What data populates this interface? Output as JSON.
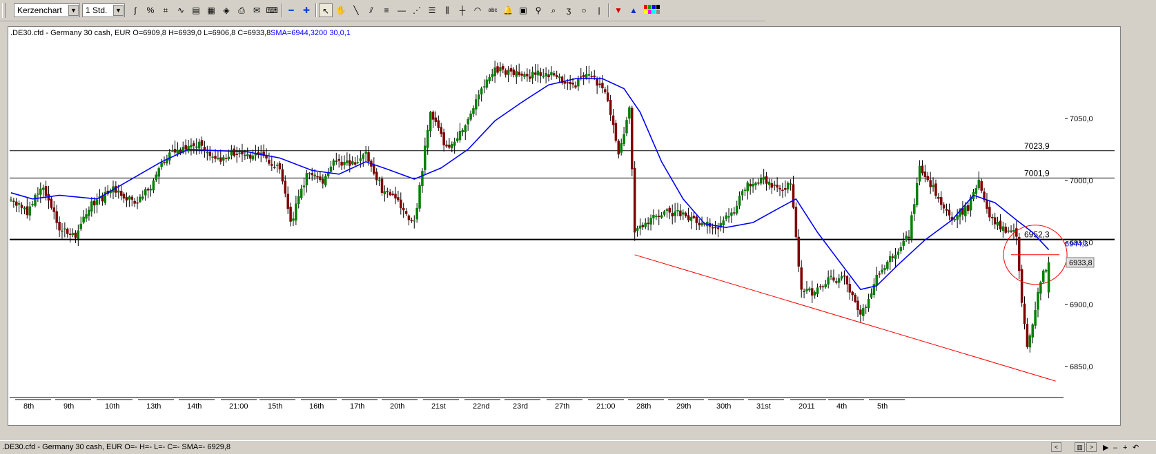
{
  "toolbar": {
    "chart_type": "Kerzenchart",
    "timeframe": "1 Std.",
    "icons": [
      "indicator-icon",
      "percent-icon",
      "crosshair-grid-icon",
      "line-tool-icon",
      "window-icon",
      "chart-window-icon",
      "book-icon",
      "print-icon",
      "mail-icon",
      "keyboard-icon",
      "zoom-out-icon",
      "zoom-in-icon",
      "pointer-icon",
      "hand-icon",
      "line-icon",
      "parallel-lines-icon",
      "channel-icon",
      "horizontal-line-icon",
      "fan-icon",
      "fibonacci-icon",
      "fibonacci-time-icon",
      "cross-icon",
      "arc-icon",
      "text-icon",
      "bell-icon",
      "calculator-icon",
      "search-icon",
      "zoom-area-icon",
      "freehand-icon",
      "circle-icon",
      "vertical-line-icon",
      "sell-arrow-icon",
      "buy-arrow-icon",
      "color-palette-icon"
    ]
  },
  "chart": {
    "header": ".DE30.cfd - Germany 30 cash, EUR O=6909,8 H=6939,0 L=6906,8 C=6933,8",
    "indicator": "SMA=6944,3200  30,0,1",
    "ytick_labels": [
      "7050,0",
      "7000,0",
      "6950,0",
      "6900,0",
      "6850,0"
    ],
    "hline_labels": [
      "7023,9",
      "7001,9",
      "6952,3"
    ],
    "price_tag": "6933,8",
    "sma_tag": "6944,3",
    "date_labels": [
      "8th",
      "9th",
      "10th",
      "13th",
      "14th",
      "21:00",
      "15th",
      "16th",
      "17th",
      "20th",
      "21st",
      "22nd",
      "23rd",
      "27th",
      "21:00",
      "28th",
      "29th",
      "30th",
      "31st",
      "2011",
      "4th",
      "5th"
    ],
    "colors": {
      "up": "#008000",
      "down": "#800000",
      "sma": "#0000ff",
      "trend": "#ff0000",
      "hline": "#000000"
    }
  },
  "chart_data": {
    "type": "candlestick",
    "symbol": ".DE30.cfd - Germany 30 cash",
    "timeframe": "1 Std.",
    "last_bar": {
      "open": 6909.8,
      "high": 6939.0,
      "low": 6906.8,
      "close": 6933.8
    },
    "sma": {
      "value": 6944.32,
      "params": "30,0,1"
    },
    "horizontal_lines": [
      7023.9,
      7001.9,
      6952.3
    ],
    "ylim": [
      6826,
      7116
    ],
    "yticks": [
      7050,
      7000,
      6950,
      6900,
      6850
    ],
    "close_path": [
      {
        "i": 0,
        "c": 6985
      },
      {
        "i": 6,
        "c": 6975
      },
      {
        "i": 12,
        "c": 6996
      },
      {
        "i": 18,
        "c": 6962
      },
      {
        "i": 24,
        "c": 6955
      },
      {
        "i": 30,
        "c": 6980
      },
      {
        "i": 38,
        "c": 6992
      },
      {
        "i": 46,
        "c": 6982
      },
      {
        "i": 52,
        "c": 6996
      },
      {
        "i": 58,
        "c": 7020
      },
      {
        "i": 64,
        "c": 7025
      },
      {
        "i": 70,
        "c": 7030
      },
      {
        "i": 76,
        "c": 7015
      },
      {
        "i": 82,
        "c": 7022
      },
      {
        "i": 88,
        "c": 7018
      },
      {
        "i": 94,
        "c": 7020
      },
      {
        "i": 100,
        "c": 7008
      },
      {
        "i": 104,
        "c": 6965
      },
      {
        "i": 110,
        "c": 7005
      },
      {
        "i": 116,
        "c": 7000
      },
      {
        "i": 120,
        "c": 7018
      },
      {
        "i": 126,
        "c": 7012
      },
      {
        "i": 132,
        "c": 7020
      },
      {
        "i": 138,
        "c": 6993
      },
      {
        "i": 144,
        "c": 6982
      },
      {
        "i": 150,
        "c": 6965
      },
      {
        "i": 156,
        "c": 7055
      },
      {
        "i": 162,
        "c": 7025
      },
      {
        "i": 168,
        "c": 7040
      },
      {
        "i": 174,
        "c": 7068
      },
      {
        "i": 180,
        "c": 7090
      },
      {
        "i": 186,
        "c": 7086
      },
      {
        "i": 192,
        "c": 7084
      },
      {
        "i": 198,
        "c": 7087
      },
      {
        "i": 204,
        "c": 7082
      },
      {
        "i": 210,
        "c": 7078
      },
      {
        "i": 216,
        "c": 7086
      },
      {
        "i": 222,
        "c": 7065
      },
      {
        "i": 226,
        "c": 7020
      },
      {
        "i": 230,
        "c": 7058
      },
      {
        "i": 232,
        "c": 6958
      },
      {
        "i": 238,
        "c": 6968
      },
      {
        "i": 244,
        "c": 6975
      },
      {
        "i": 250,
        "c": 6972
      },
      {
        "i": 256,
        "c": 6965
      },
      {
        "i": 262,
        "c": 6962
      },
      {
        "i": 268,
        "c": 6972
      },
      {
        "i": 274,
        "c": 6998
      },
      {
        "i": 280,
        "c": 7000
      },
      {
        "i": 286,
        "c": 6993
      },
      {
        "i": 290,
        "c": 6998
      },
      {
        "i": 294,
        "c": 6912
      },
      {
        "i": 298,
        "c": 6910
      },
      {
        "i": 304,
        "c": 6920
      },
      {
        "i": 310,
        "c": 6920
      },
      {
        "i": 316,
        "c": 6890
      },
      {
        "i": 322,
        "c": 6922
      },
      {
        "i": 328,
        "c": 6940
      },
      {
        "i": 334,
        "c": 6955
      },
      {
        "i": 338,
        "c": 7010
      },
      {
        "i": 344,
        "c": 6990
      },
      {
        "i": 350,
        "c": 6970
      },
      {
        "i": 356,
        "c": 6978
      },
      {
        "i": 360,
        "c": 7000
      },
      {
        "i": 364,
        "c": 6970
      },
      {
        "i": 368,
        "c": 6962
      },
      {
        "i": 374,
        "c": 6957
      },
      {
        "i": 376,
        "c": 6900
      },
      {
        "i": 378,
        "c": 6865
      },
      {
        "i": 380,
        "c": 6885
      },
      {
        "i": 383,
        "c": 6920
      },
      {
        "i": 386,
        "c": 6934
      }
    ],
    "sma_path": [
      {
        "i": 0,
        "c": 6990
      },
      {
        "i": 8,
        "c": 6985
      },
      {
        "i": 18,
        "c": 6988
      },
      {
        "i": 32,
        "c": 6985
      },
      {
        "i": 44,
        "c": 7000
      },
      {
        "i": 56,
        "c": 7015
      },
      {
        "i": 66,
        "c": 7025
      },
      {
        "i": 76,
        "c": 7024
      },
      {
        "i": 88,
        "c": 7023
      },
      {
        "i": 100,
        "c": 7018
      },
      {
        "i": 112,
        "c": 7008
      },
      {
        "i": 122,
        "c": 7005
      },
      {
        "i": 132,
        "c": 7015
      },
      {
        "i": 140,
        "c": 7009
      },
      {
        "i": 150,
        "c": 7001
      },
      {
        "i": 160,
        "c": 7010
      },
      {
        "i": 170,
        "c": 7025
      },
      {
        "i": 180,
        "c": 7048
      },
      {
        "i": 190,
        "c": 7063
      },
      {
        "i": 200,
        "c": 7077
      },
      {
        "i": 210,
        "c": 7082
      },
      {
        "i": 220,
        "c": 7082
      },
      {
        "i": 228,
        "c": 7074
      },
      {
        "i": 234,
        "c": 7055
      },
      {
        "i": 242,
        "c": 7015
      },
      {
        "i": 250,
        "c": 6985
      },
      {
        "i": 258,
        "c": 6965
      },
      {
        "i": 266,
        "c": 6962
      },
      {
        "i": 276,
        "c": 6966
      },
      {
        "i": 286,
        "c": 6978
      },
      {
        "i": 292,
        "c": 6985
      },
      {
        "i": 300,
        "c": 6958
      },
      {
        "i": 308,
        "c": 6935
      },
      {
        "i": 316,
        "c": 6912
      },
      {
        "i": 322,
        "c": 6915
      },
      {
        "i": 330,
        "c": 6932
      },
      {
        "i": 340,
        "c": 6952
      },
      {
        "i": 350,
        "c": 6968
      },
      {
        "i": 358,
        "c": 6988
      },
      {
        "i": 366,
        "c": 6982
      },
      {
        "i": 374,
        "c": 6968
      },
      {
        "i": 380,
        "c": 6958
      },
      {
        "i": 386,
        "c": 6944
      }
    ],
    "trendline": [
      {
        "i": 232,
        "c": 6940
      },
      {
        "i": 386,
        "c": 6837
      }
    ],
    "signal_segment": [
      {
        "i": 372,
        "c": 6940
      },
      {
        "i": 390,
        "c": 6940
      }
    ]
  },
  "statusbar": {
    "text": ".DE30.cfd - Germany 30 cash, EUR O=- H=- L=- C=-  SMA=-   6929,8"
  }
}
